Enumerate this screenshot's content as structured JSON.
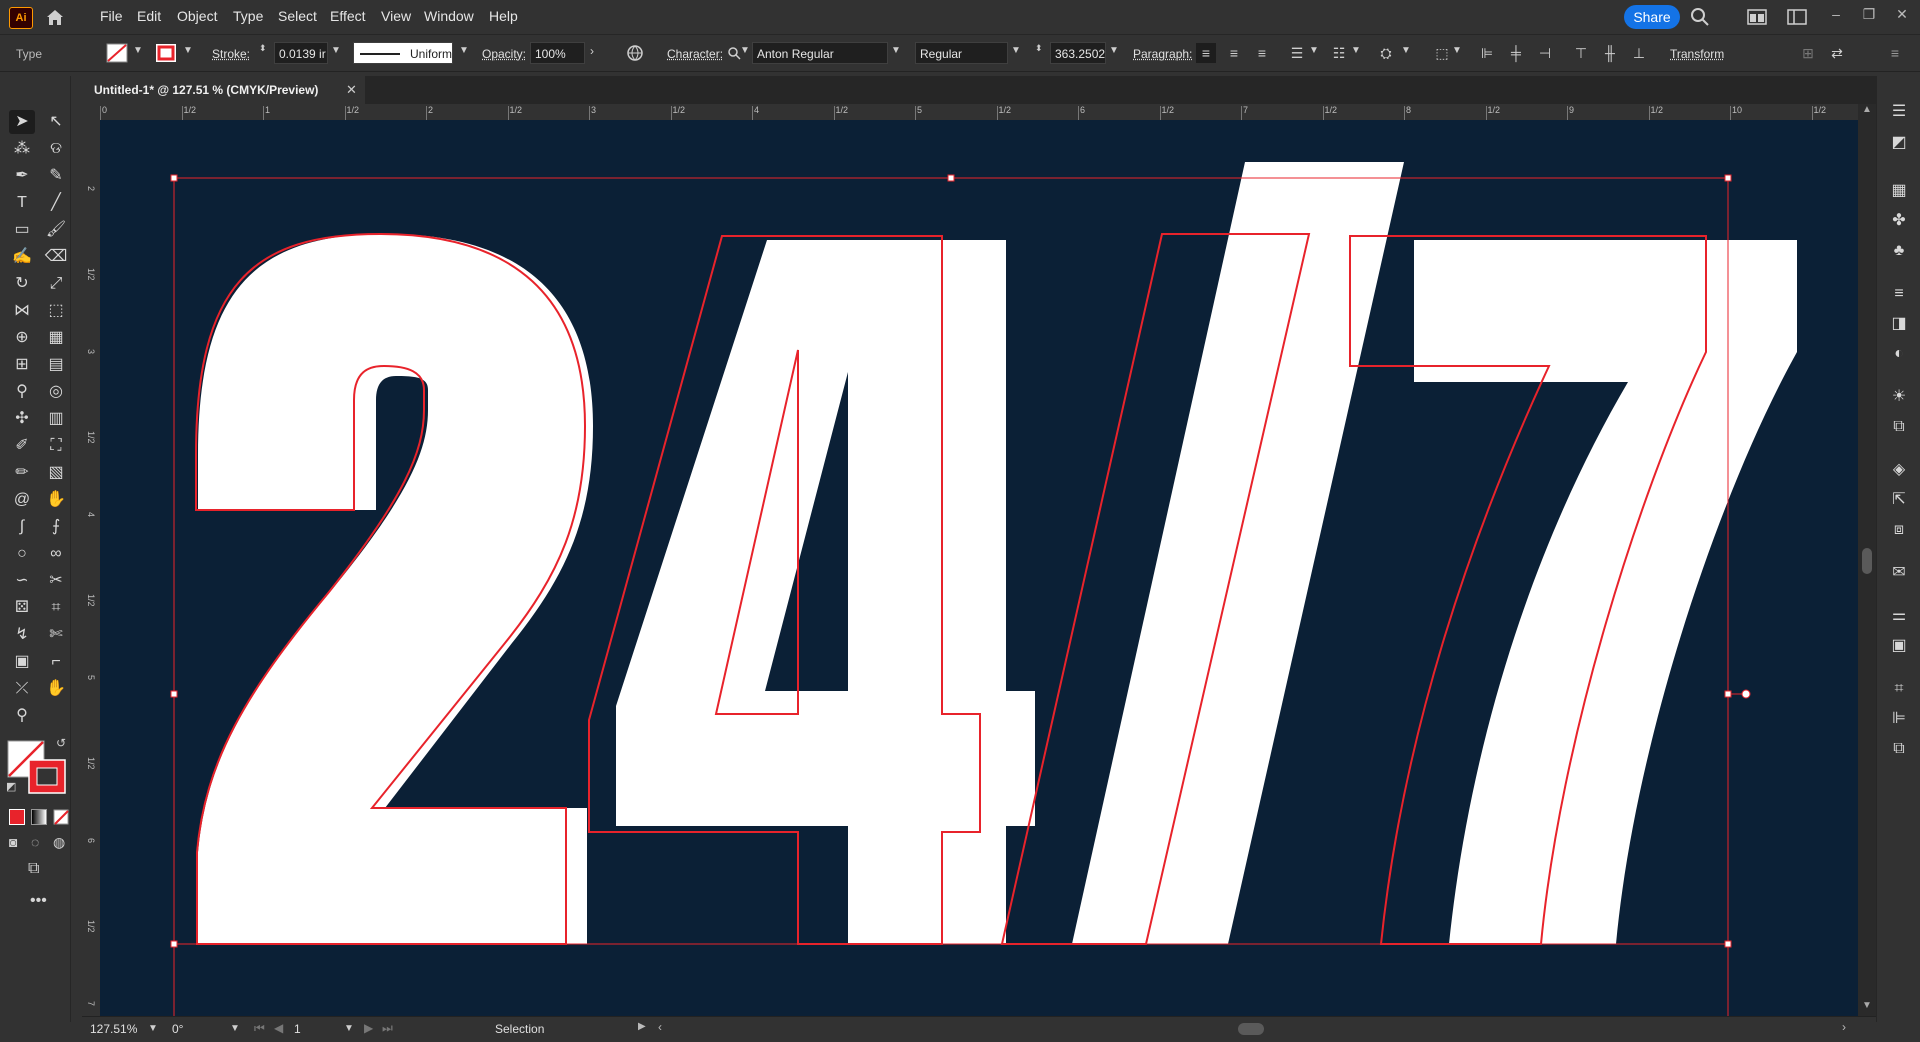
{
  "app": {
    "logo": "Ai"
  },
  "menu": [
    "File",
    "Edit",
    "Object",
    "Type",
    "Select",
    "Effect",
    "View",
    "Window",
    "Help"
  ],
  "share_label": "Share",
  "control": {
    "mode": "Type",
    "stroke_label": "Stroke:",
    "stroke_value": "0.0139 ir",
    "stroke_profile": "Uniform",
    "opacity_label": "Opacity:",
    "opacity_value": "100%",
    "character_label": "Character:",
    "font_family": "Anton Regular",
    "font_style": "Regular",
    "font_size": "363.2502",
    "paragraph_label": "Paragraph:",
    "transform_label": "Transform"
  },
  "document": {
    "tab_title": "Untitled-1* @ 127.51 % (CMYK/Preview)"
  },
  "ruler": {
    "h_labels": [
      "0",
      "1/2",
      "1",
      "1/2",
      "2",
      "1/2",
      "3",
      "1/2",
      "4",
      "1/2",
      "5",
      "1/2",
      "6",
      "1/2",
      "7",
      "1/2",
      "8",
      "1/2",
      "9",
      "1/2",
      "10",
      "1/2"
    ],
    "v_labels": [
      "2",
      "1/2",
      "3",
      "1/2",
      "4",
      "1/2",
      "5",
      "1/2",
      "6",
      "1/2",
      "7"
    ]
  },
  "artwork": {
    "text": "24/7",
    "glyphs": [
      "2",
      "4",
      "/",
      "7"
    ],
    "fill_color": "#ffffff",
    "background_color": "#0b2036",
    "outline_color": "#e8232b"
  },
  "status": {
    "zoom": "127.51%",
    "rotation": "0°",
    "artboard": "1",
    "tool": "Selection"
  },
  "colors": {
    "accent": "#1473e6",
    "selection": "#e8232b",
    "chrome": "#323232"
  }
}
